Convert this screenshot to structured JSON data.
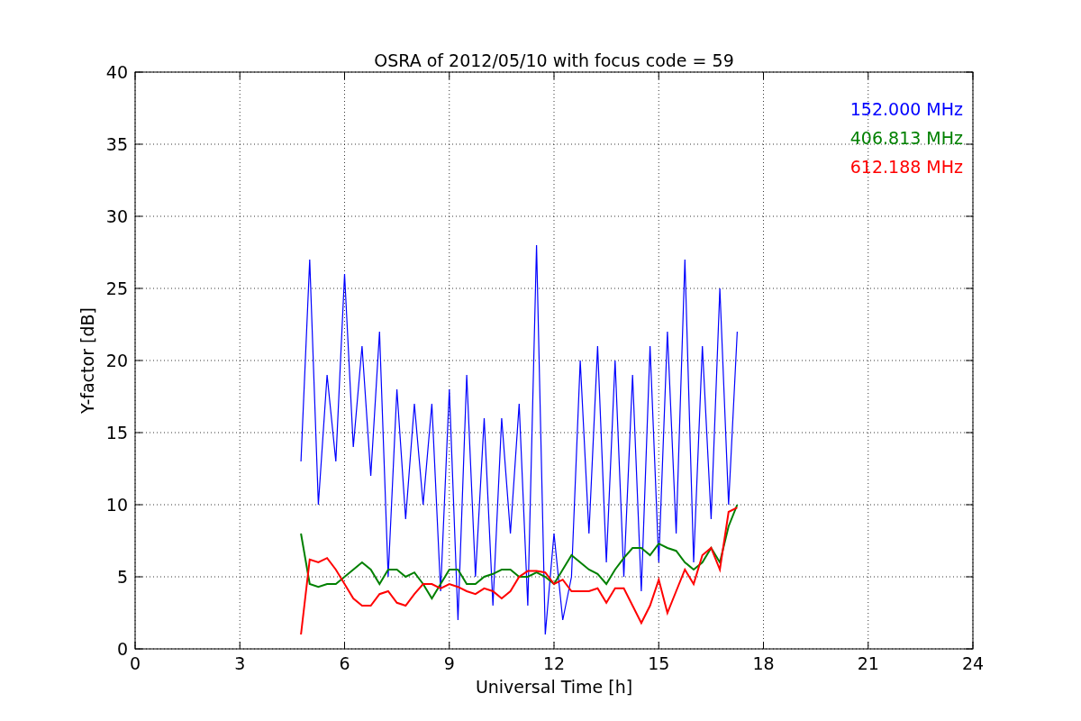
{
  "figure": {
    "chart_data": {
      "type": "line",
      "title": "OSRA of 2012/05/10 with focus code = 59",
      "xlabel": "Universal Time [h]",
      "ylabel": "Y-factor [dB]",
      "x": [
        4.75,
        5,
        5.25,
        5.5,
        5.75,
        6,
        6.25,
        6.5,
        6.75,
        7,
        7.25,
        7.5,
        7.75,
        8,
        8.25,
        8.5,
        8.75,
        9,
        9.25,
        9.5,
        9.75,
        10,
        10.25,
        10.5,
        10.75,
        11,
        11.25,
        11.5,
        11.75,
        12,
        12.25,
        12.5,
        12.75,
        13,
        13.25,
        13.5,
        13.75,
        14,
        14.25,
        14.5,
        14.75,
        15,
        15.25,
        15.5,
        15.75,
        16,
        16.25,
        16.5,
        16.75,
        17,
        17.25
      ],
      "series": [
        {
          "name": "152.000 MHz",
          "color": "#0000ff",
          "values": [
            13,
            27,
            10,
            19,
            13,
            26,
            14,
            21,
            12,
            22,
            5,
            18,
            9,
            17,
            10,
            17,
            4,
            18,
            2,
            19,
            5,
            16,
            3,
            16,
            8,
            17,
            3,
            28,
            1,
            8,
            2,
            5,
            20,
            8,
            21,
            6,
            20,
            5,
            19,
            4,
            21,
            6,
            22,
            8,
            27,
            6,
            21,
            9,
            25,
            10,
            22
          ]
        },
        {
          "name": "406.813 MHz",
          "color": "#008000",
          "values": [
            8,
            4.5,
            4.3,
            4.5,
            4.5,
            5,
            5.5,
            6,
            5.5,
            4.5,
            5.5,
            5.5,
            5,
            5.3,
            4.5,
            3.5,
            4.5,
            5.5,
            5.5,
            4.5,
            4.5,
            5,
            5.2,
            5.5,
            5.5,
            5,
            5,
            5.3,
            5,
            4.5,
            5.5,
            6.5,
            6,
            5.5,
            5.2,
            4.5,
            5.5,
            6.3,
            7,
            7,
            6.5,
            7.3,
            7,
            6.8,
            6,
            5.5,
            6,
            7,
            6,
            8.5,
            10
          ]
        },
        {
          "name": "612.188 MHz",
          "color": "#ff0000",
          "values": [
            1,
            6.2,
            6,
            6.3,
            5.5,
            4.5,
            3.5,
            3,
            3,
            3.8,
            4,
            3.2,
            3,
            3.8,
            4.5,
            4.5,
            4.2,
            4.5,
            4.3,
            4,
            3.8,
            4.2,
            4,
            3.5,
            4,
            5,
            5.4,
            5.4,
            5.3,
            4.5,
            4.8,
            4,
            4,
            4,
            4.2,
            3.2,
            4.2,
            4.2,
            3,
            1.8,
            3,
            4.8,
            2.5,
            4,
            5.5,
            4.5,
            6.5,
            7,
            5.5,
            9.5,
            9.8
          ]
        }
      ],
      "xlim": [
        0,
        24
      ],
      "ylim": [
        0,
        40
      ],
      "xticks": [
        0,
        3,
        6,
        9,
        12,
        15,
        18,
        21,
        24
      ],
      "yticks": [
        0,
        5,
        10,
        15,
        20,
        25,
        30,
        35,
        40
      ],
      "grid": true
    }
  }
}
